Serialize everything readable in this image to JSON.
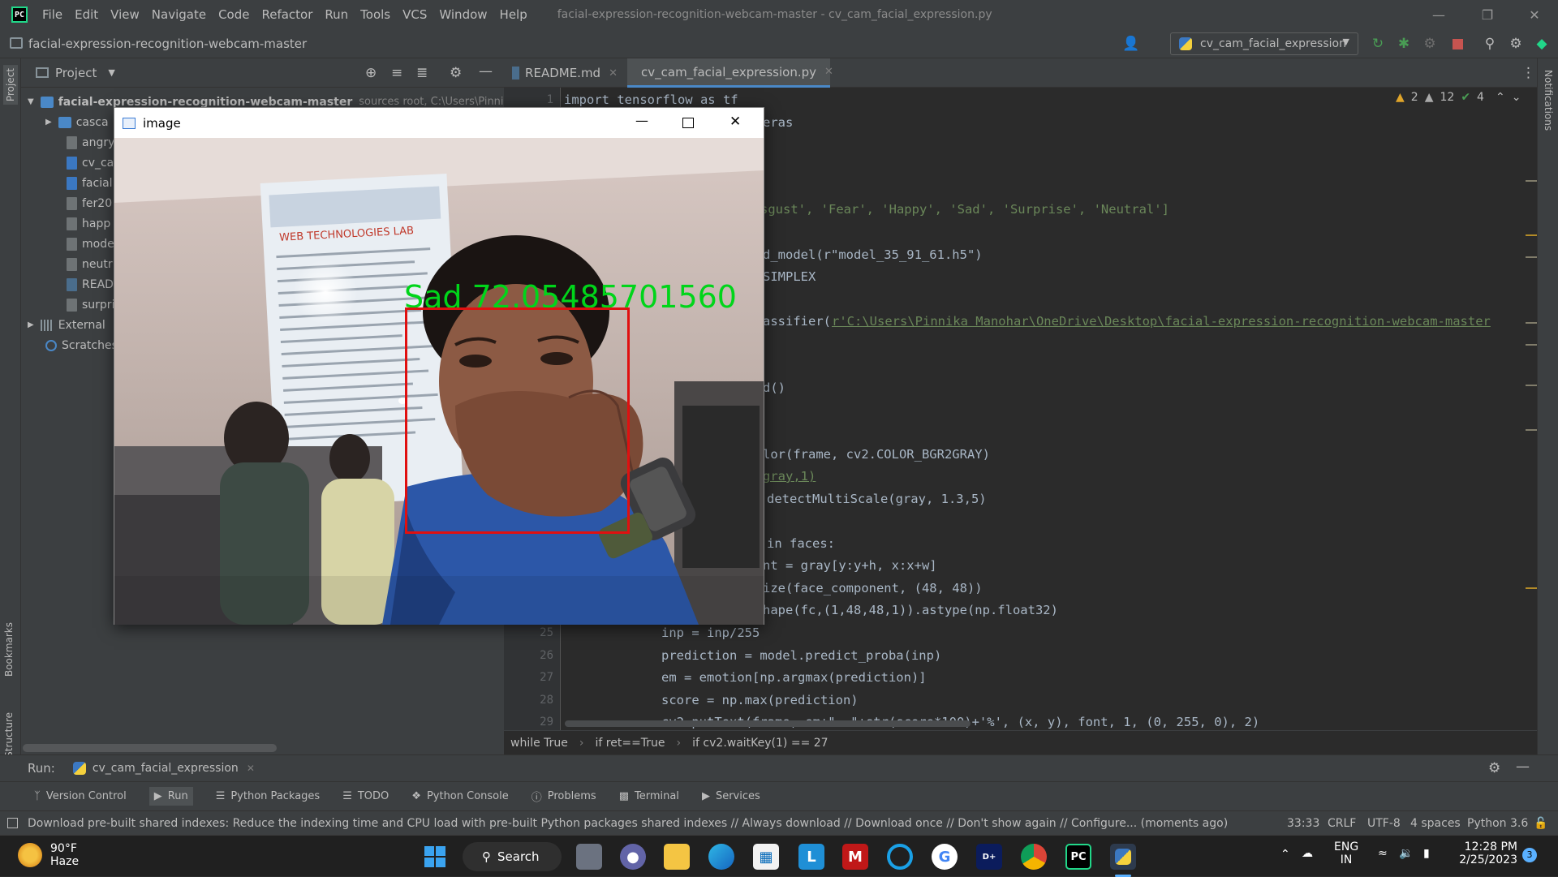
{
  "titlebar": {
    "menu": [
      "File",
      "Edit",
      "View",
      "Navigate",
      "Code",
      "Refactor",
      "Run",
      "Tools",
      "VCS",
      "Window",
      "Help"
    ],
    "window_title": "facial-expression-recognition-webcam-master - cv_cam_facial_expression.py"
  },
  "navbar": {
    "project_name": "facial-expression-recognition-webcam-master",
    "run_config": "cv_cam_facial_expression"
  },
  "left_strip": {
    "project": "Project",
    "bookmarks": "Bookmarks",
    "structure": "Structure"
  },
  "right_strip": {
    "notifications": "Notifications"
  },
  "project_panel": {
    "header": "Project",
    "root": "facial-expression-recognition-webcam-master",
    "root_hint": "sources root, C:\\Users\\Pinnika I",
    "items": [
      "casca",
      "angry",
      "cv_ca",
      "facial",
      "fer20",
      "happ",
      "mode",
      "neutr",
      "READ",
      "surpri"
    ],
    "external": "External",
    "scratches": "Scratches"
  },
  "tabs": [
    {
      "label": "README.md"
    },
    {
      "label": "cv_cam_facial_expression.py"
    }
  ],
  "inspections": {
    "warnings": "2",
    "weak_warnings": "12",
    "ok": "4"
  },
  "editor": {
    "line1": "import tensorflow as tf",
    "line2": "eras",
    "line5": "sgust', 'Fear', 'Happy', 'Sad', 'Surprise', 'Neutral']",
    "line7": "d_model(r\"model_35_91_61.h5\")",
    "line8": "SIMPLEX",
    "line10a": "assifier(",
    "line10b": "r'C:\\Users\\Pinnika Manohar\\OneDrive\\Desktop\\facial-expression-recognition-webcam-master",
    "line13": "d()",
    "line16": "lor(frame, cv2.COLOR_BGR2GRAY)",
    "line17": "gray,1)",
    "line18": "detectMultiScale(gray, 1.3,5)",
    "line20": "in faces:",
    "line21": "nt = gray[y:y+h, x:x+w]",
    "line22": "ize(face_component, (48, 48))",
    "line23": "hape(fc,(1,48,48,1)).astype(np.float32)",
    "line25": "inp = inp/255",
    "line26": "prediction = model.predict_proba(inp)",
    "line27": "em = emotion[np.argmax(prediction)]",
    "line28": "score = np.max(prediction)",
    "line29": "cv2.putText(frame, em+\"  \"+str(score*100)+'%', (x, y), font, 1, (0, 255, 0), 2)",
    "ln1": "1",
    "ln25": "25",
    "ln26": "26",
    "ln27": "27",
    "ln28": "28",
    "ln29": "29"
  },
  "breadcrumbs": [
    "while True",
    "if ret==True",
    "if cv2.waitKey(1) == 27"
  ],
  "runbar": {
    "label": "Run:",
    "config": "cv_cam_facial_expression"
  },
  "toolwindows": [
    "Version Control",
    "Run",
    "Python Packages",
    "TODO",
    "Python Console",
    "Problems",
    "Terminal",
    "Services"
  ],
  "status": {
    "message": "Download pre-built shared indexes: Reduce the indexing time and CPU load with pre-built Python packages shared indexes // Always download // Download once // Don't show again // Configure... (moments ago)",
    "position": "33:33",
    "line_sep": "CRLF",
    "encoding": "UTF-8",
    "indent": "4 spaces",
    "interpreter": "Python 3.6"
  },
  "image_window": {
    "title": "image",
    "emotion_text": "Sad   72.05485701560",
    "poster_text": "WEB TECHNOLOGIES LAB"
  },
  "taskbar": {
    "temp": "90°F",
    "weather": "Haze",
    "search": "Search",
    "lang1": "ENG",
    "lang2": "IN",
    "time": "12:28 PM",
    "date": "2/25/2023",
    "badge": "3"
  }
}
